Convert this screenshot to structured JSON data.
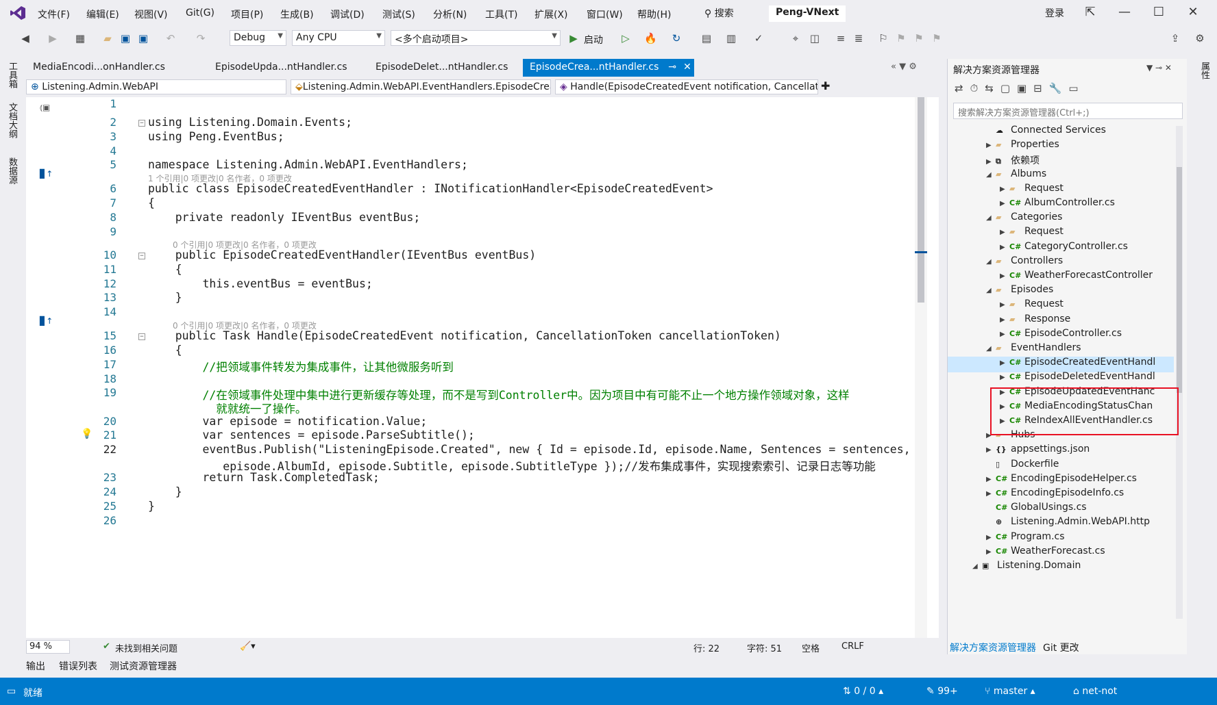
{
  "menubar": {
    "items": [
      "文件(F)",
      "编辑(E)",
      "视图(V)",
      "Git(G)",
      "项目(P)",
      "生成(B)",
      "调试(D)",
      "测试(S)",
      "分析(N)",
      "工具(T)",
      "扩展(X)",
      "窗口(W)",
      "帮助(H)"
    ],
    "search_label": "搜索",
    "solution_name": "Peng-VNext",
    "login_label": "登录"
  },
  "toolbar": {
    "config": "Debug",
    "platform": "Any CPU",
    "startup": "<多个启动项目>",
    "start_label": "启动"
  },
  "left_rail": [
    "工具箱",
    "文档大纲",
    "数据源"
  ],
  "right_rail": [
    "属性"
  ],
  "tabs": [
    {
      "label": "MediaEncodi...onHandler.cs",
      "active": false
    },
    {
      "label": "EpisodeUpda...ntHandler.cs",
      "active": false
    },
    {
      "label": "EpisodeDelet...ntHandler.cs",
      "active": false
    },
    {
      "label": "EpisodeCrea...ntHandler.cs",
      "active": true
    }
  ],
  "navbar": {
    "project": "Listening.Admin.WebAPI",
    "type": "Listening.Admin.WebAPI.EventHandlers.EpisodeCreat",
    "member": "Handle(EpisodeCreatedEvent notification, Cancellatio"
  },
  "code": {
    "lines": [
      {
        "n": "1",
        "text": ""
      },
      {
        "n": "2",
        "text": "using Listening.Domain.Events;"
      },
      {
        "n": "3",
        "text": "using Peng.EventBus;"
      },
      {
        "n": "4",
        "text": ""
      },
      {
        "n": "5",
        "text": "namespace Listening.Admin.WebAPI.EventHandlers;"
      },
      {
        "n": "6",
        "text": "public class EpisodeCreatedEventHandler : INotificationHandler<EpisodeCreatedEvent>"
      },
      {
        "n": "7",
        "text": "{"
      },
      {
        "n": "8",
        "text": "    private readonly IEventBus eventBus;"
      },
      {
        "n": "9",
        "text": ""
      },
      {
        "n": "10",
        "text": "    public EpisodeCreatedEventHandler(IEventBus eventBus)"
      },
      {
        "n": "11",
        "text": "    {"
      },
      {
        "n": "12",
        "text": "        this.eventBus = eventBus;"
      },
      {
        "n": "13",
        "text": "    }"
      },
      {
        "n": "14",
        "text": ""
      },
      {
        "n": "15",
        "text": "    public Task Handle(EpisodeCreatedEvent notification, CancellationToken cancellationToken)"
      },
      {
        "n": "16",
        "text": "    {"
      },
      {
        "n": "17",
        "text": "        //把领域事件转发为集成事件，让其他微服务听到"
      },
      {
        "n": "18",
        "text": ""
      },
      {
        "n": "19",
        "text": "        //在领域事件处理中集中进行更新缓存等处理，而不是写到Controller中。因为项目中有可能不止一个地方操作领域对象，这样"
      },
      {
        "n": "",
        "text": "          就就统一了操作。"
      },
      {
        "n": "20",
        "text": "        var episode = notification.Value;"
      },
      {
        "n": "21",
        "text": "        var sentences = episode.ParseSubtitle();"
      },
      {
        "n": "22",
        "text": "        eventBus.Publish(\"ListeningEpisode.Created\", new { Id = episode.Id, episode.Name, Sentences = sentences,"
      },
      {
        "n": "",
        "text": "           episode.AlbumId, episode.Subtitle, episode.SubtitleType });//发布集成事件，实现搜索索引、记录日志等功能"
      },
      {
        "n": "23",
        "text": "        return Task.CompletedTask;"
      },
      {
        "n": "24",
        "text": "    }"
      },
      {
        "n": "25",
        "text": "}"
      },
      {
        "n": "26",
        "text": ""
      }
    ],
    "lens_6": "1 个引用|0 项更改|0 名作者，0 项更改",
    "lens_10": "0 个引用|0 项更改|0 名作者，0 项更改",
    "lens_15": "0 个引用|0 项更改|0 名作者，0 项更改"
  },
  "editor_status": {
    "zoom": "94 %",
    "issues": "未找到相关问题",
    "row": "行: 22",
    "col": "字符: 51",
    "ws": "空格",
    "eol": "CRLF"
  },
  "bottom_tabs": [
    "输出",
    "错误列表",
    "测试资源管理器"
  ],
  "statusbar": {
    "ready": "就绪",
    "changes": "0 / 0",
    "edits": "99+",
    "branch": "master",
    "repo": "net-not"
  },
  "solution_explorer": {
    "title": "解决方案资源管理器",
    "search_placeholder": "搜索解决方案资源管理器(Ctrl+;)",
    "items": [
      {
        "label": "Connected Services",
        "indent": 0,
        "kind": "svc",
        "exp": ""
      },
      {
        "label": "Properties",
        "indent": 0,
        "kind": "folder",
        "exp": "▶"
      },
      {
        "label": "依赖项",
        "indent": 0,
        "kind": "deps",
        "exp": "▶"
      },
      {
        "label": "Albums",
        "indent": 0,
        "kind": "folder",
        "exp": "◢"
      },
      {
        "label": "Request",
        "indent": 1,
        "kind": "folder",
        "exp": "▶"
      },
      {
        "label": "AlbumController.cs",
        "indent": 1,
        "kind": "cs",
        "exp": "▶"
      },
      {
        "label": "Categories",
        "indent": 0,
        "kind": "folder",
        "exp": "◢"
      },
      {
        "label": "Request",
        "indent": 1,
        "kind": "folder",
        "exp": "▶"
      },
      {
        "label": "CategoryController.cs",
        "indent": 1,
        "kind": "cs",
        "exp": "▶"
      },
      {
        "label": "Controllers",
        "indent": 0,
        "kind": "folder",
        "exp": "◢"
      },
      {
        "label": "WeatherForecastController",
        "indent": 1,
        "kind": "cs",
        "exp": "▶"
      },
      {
        "label": "Episodes",
        "indent": 0,
        "kind": "folder",
        "exp": "◢"
      },
      {
        "label": "Request",
        "indent": 1,
        "kind": "folder",
        "exp": "▶"
      },
      {
        "label": "Response",
        "indent": 1,
        "kind": "folder",
        "exp": "▶"
      },
      {
        "label": "EpisodeController.cs",
        "indent": 1,
        "kind": "cs",
        "exp": "▶"
      },
      {
        "label": "EventHandlers",
        "indent": 0,
        "kind": "folder",
        "exp": "◢"
      },
      {
        "label": "EpisodeCreatedEventHandl",
        "indent": 1,
        "kind": "cs",
        "exp": "▶",
        "selected": true
      },
      {
        "label": "EpisodeDeletedEventHandl",
        "indent": 1,
        "kind": "cs",
        "exp": "▶"
      },
      {
        "label": "EpisodeUpdatedEventHanc",
        "indent": 1,
        "kind": "cs",
        "exp": "▶"
      },
      {
        "label": "MediaEncodingStatusChan",
        "indent": 1,
        "kind": "cs",
        "exp": "▶"
      },
      {
        "label": "ReIndexAllEventHandler.cs",
        "indent": 1,
        "kind": "cs",
        "exp": "▶"
      },
      {
        "label": "Hubs",
        "indent": 0,
        "kind": "folder",
        "exp": "▶"
      },
      {
        "label": "appsettings.json",
        "indent": 0,
        "kind": "json",
        "exp": "▶"
      },
      {
        "label": "Dockerfile",
        "indent": 0,
        "kind": "file",
        "exp": ""
      },
      {
        "label": "EncodingEpisodeHelper.cs",
        "indent": 0,
        "kind": "cs",
        "exp": "▶"
      },
      {
        "label": "EncodingEpisodeInfo.cs",
        "indent": 0,
        "kind": "cs",
        "exp": "▶"
      },
      {
        "label": "GlobalUsings.cs",
        "indent": 0,
        "kind": "cs",
        "exp": ""
      },
      {
        "label": "Listening.Admin.WebAPI.http",
        "indent": 0,
        "kind": "http",
        "exp": ""
      },
      {
        "label": "Program.cs",
        "indent": 0,
        "kind": "cs",
        "exp": "▶"
      },
      {
        "label": "WeatherForecast.cs",
        "indent": 0,
        "kind": "cs",
        "exp": "▶"
      },
      {
        "label": "Listening.Domain",
        "indent": -1,
        "kind": "proj",
        "exp": "◢"
      }
    ],
    "bottom_tabs": [
      "解决方案资源管理器",
      "Git 更改"
    ]
  },
  "colors": {
    "accent": "#007acc",
    "highlight_box": "#e81123"
  }
}
